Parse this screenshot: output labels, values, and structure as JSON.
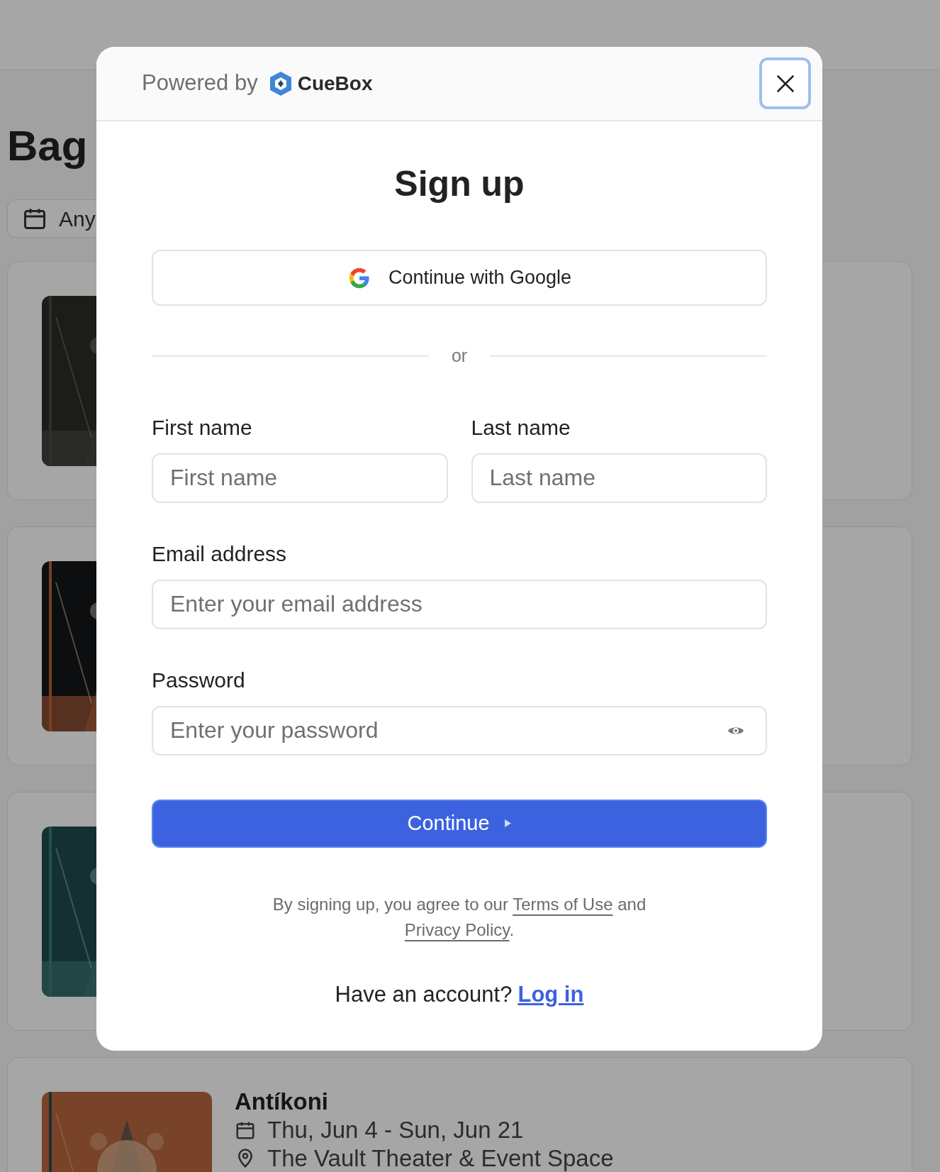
{
  "background_page": {
    "title": "Bag",
    "filter": {
      "label": "Any"
    },
    "events": [
      {
        "kind": "poster_only"
      },
      {
        "kind": "poster_only"
      },
      {
        "kind": "poster_only"
      },
      {
        "kind": "full",
        "title": "Antíkoni",
        "dates": "Thu, Jun 4 - Sun, Jun 21",
        "venue": "The Vault Theater & Event Space"
      }
    ]
  },
  "modal": {
    "powered_by": "Powered by",
    "brand": "CueBox",
    "title": "Sign up",
    "google_button": "Continue with Google",
    "divider": "or",
    "name_fields": [
      {
        "label": "First name",
        "placeholder": "First name"
      },
      {
        "label": "Last name",
        "placeholder": "Last name"
      }
    ],
    "fields": [
      {
        "kind": "email",
        "label": "Email address",
        "placeholder": "Enter your email address"
      },
      {
        "kind": "password",
        "label": "Password",
        "placeholder": "Enter your password"
      }
    ],
    "submit_button": "Continue",
    "terms": {
      "before": "By signing up, you agree to our ",
      "link_1": "Terms of Use",
      "middle": " and ",
      "link_2": "Privacy Policy",
      "after": "."
    },
    "login_prompt": {
      "text": "Have an account?",
      "link": "Log in"
    }
  }
}
